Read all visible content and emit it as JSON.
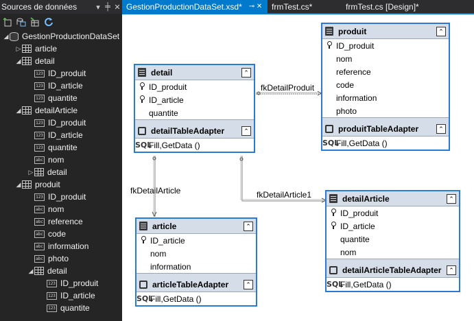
{
  "panel": {
    "title": "Sources de données",
    "title_buttons": [
      "▾",
      "╪",
      "✕"
    ],
    "toolbar_icons": [
      "add-datasource-icon",
      "edit-dataset-icon",
      "configure-icon",
      "refresh-icon"
    ],
    "tree": [
      {
        "label": "GestionProductionDataSet",
        "level": 0,
        "icon": "db",
        "arrow": "◢"
      },
      {
        "label": "article",
        "level": 1,
        "icon": "table",
        "arrow": "▷"
      },
      {
        "label": "detail",
        "level": 1,
        "icon": "table",
        "arrow": "◢"
      },
      {
        "label": "ID_produit",
        "level": 2,
        "icon": "col123"
      },
      {
        "label": "ID_article",
        "level": 2,
        "icon": "col123"
      },
      {
        "label": "quantite",
        "level": 2,
        "icon": "col123"
      },
      {
        "label": "detailArticle",
        "level": 1,
        "icon": "table",
        "arrow": "◢"
      },
      {
        "label": "ID_produit",
        "level": 2,
        "icon": "col123"
      },
      {
        "label": "ID_article",
        "level": 2,
        "icon": "col123"
      },
      {
        "label": "quantite",
        "level": 2,
        "icon": "col123"
      },
      {
        "label": "nom",
        "level": 2,
        "icon": "colabc"
      },
      {
        "label": "detail",
        "level": 2,
        "icon": "table",
        "arrow": "▷"
      },
      {
        "label": "produit",
        "level": 1,
        "icon": "table",
        "arrow": "◢"
      },
      {
        "label": "ID_produit",
        "level": 2,
        "icon": "col123"
      },
      {
        "label": "nom",
        "level": 2,
        "icon": "colabc"
      },
      {
        "label": "reference",
        "level": 2,
        "icon": "colabc"
      },
      {
        "label": "code",
        "level": 2,
        "icon": "colabc"
      },
      {
        "label": "information",
        "level": 2,
        "icon": "colabc"
      },
      {
        "label": "photo",
        "level": 2,
        "icon": "colabc"
      },
      {
        "label": "detail",
        "level": 2,
        "icon": "table",
        "arrow": "◢"
      },
      {
        "label": "ID_produit",
        "level": 3,
        "icon": "col123"
      },
      {
        "label": "ID_article",
        "level": 3,
        "icon": "col123"
      },
      {
        "label": "quantite",
        "level": 3,
        "icon": "col123"
      }
    ],
    "col123_text": "123",
    "colabc_text": "abc"
  },
  "tabs": [
    {
      "label": "GestionProductionDataSet.xsd*",
      "active": true,
      "close": "⊸ ✕"
    },
    {
      "label": "frmTest.cs*",
      "active": false
    },
    {
      "label": "frmTest.cs [Design]*",
      "active": false
    }
  ],
  "designer": {
    "collapse_glyph": "⌃",
    "method": "Fill,GetData ()",
    "sql_label": "SQL",
    "tables": {
      "detail": {
        "name": "detail",
        "adapter": "detailTableAdapter",
        "columns": [
          {
            "name": "ID_produit",
            "key": true
          },
          {
            "name": "ID_article",
            "key": true
          },
          {
            "name": "quantite",
            "key": false
          }
        ]
      },
      "produit": {
        "name": "produit",
        "adapter": "produitTableAdapter",
        "columns": [
          {
            "name": "ID_produit",
            "key": true
          },
          {
            "name": "nom",
            "key": false
          },
          {
            "name": "reference",
            "key": false
          },
          {
            "name": "code",
            "key": false
          },
          {
            "name": "information",
            "key": false
          },
          {
            "name": "photo",
            "key": false
          }
        ]
      },
      "article": {
        "name": "article",
        "adapter": "articleTableAdapter",
        "columns": [
          {
            "name": "ID_article",
            "key": true
          },
          {
            "name": "nom",
            "key": false
          },
          {
            "name": "information",
            "key": false
          }
        ]
      },
      "detailArticle": {
        "name": "detailArticle",
        "adapter": "detailArticleTableAdapter",
        "columns": [
          {
            "name": "ID_produit",
            "key": true
          },
          {
            "name": "ID_article",
            "key": true
          },
          {
            "name": "quantite",
            "key": false
          },
          {
            "name": "nom",
            "key": false
          }
        ]
      }
    },
    "relations": {
      "fkDetailProduit": "fkDetailProduit",
      "fkDetailArticle": "fkDetailArticle",
      "fkDetailArticle1": "fkDetailArticle1"
    }
  }
}
